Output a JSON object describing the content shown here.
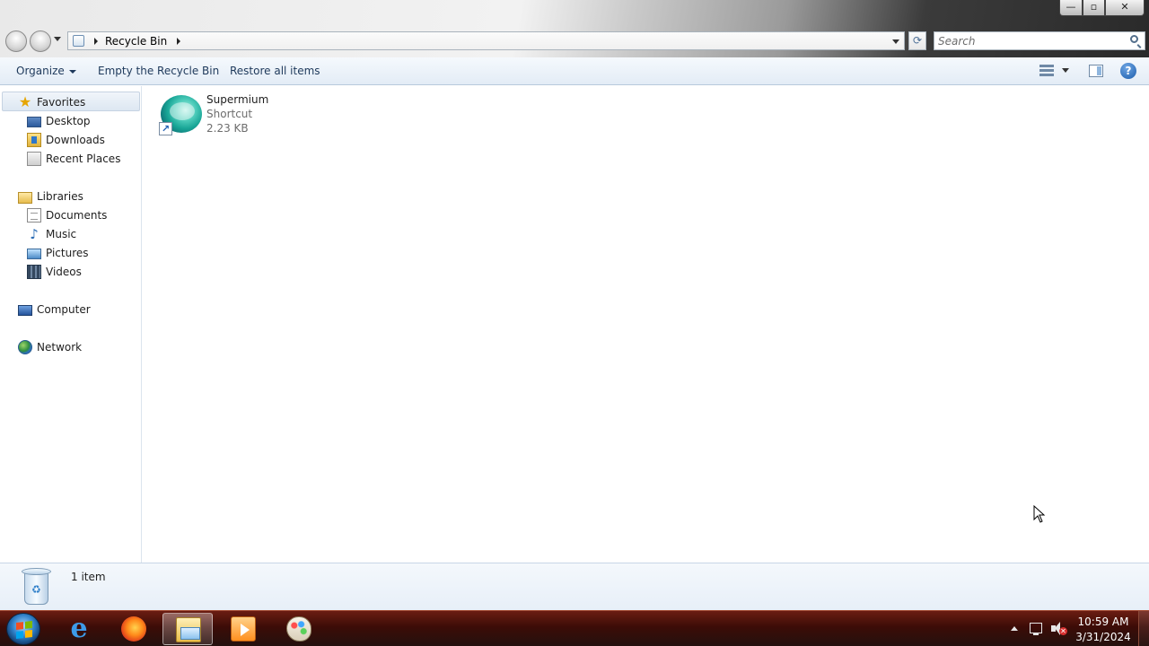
{
  "window": {
    "controls": {
      "minimize": "—",
      "maximize": "▫",
      "close": "✕"
    }
  },
  "address_bar": {
    "breadcrumb": "Recycle Bin",
    "refresh_glyph": "⟳"
  },
  "search": {
    "placeholder": "Search"
  },
  "command_bar": {
    "organize_label": "Organize",
    "empty_label": "Empty the Recycle Bin",
    "restore_label": "Restore all items",
    "help_glyph": "?"
  },
  "nav_pane": {
    "favorites": {
      "label": "Favorites",
      "items": [
        {
          "label": "Desktop",
          "icon": "desktop-icon"
        },
        {
          "label": "Downloads",
          "icon": "downloads-icon"
        },
        {
          "label": "Recent Places",
          "icon": "recent-places-icon"
        }
      ]
    },
    "libraries": {
      "label": "Libraries",
      "items": [
        {
          "label": "Documents",
          "icon": "documents-icon"
        },
        {
          "label": "Music",
          "icon": "music-icon"
        },
        {
          "label": "Pictures",
          "icon": "pictures-icon"
        },
        {
          "label": "Videos",
          "icon": "videos-icon"
        }
      ]
    },
    "computer": {
      "label": "Computer"
    },
    "network": {
      "label": "Network"
    }
  },
  "content": {
    "items": [
      {
        "name": "Supermium",
        "type": "Shortcut",
        "size": "2.23 KB"
      }
    ]
  },
  "details": {
    "count": "1 item"
  },
  "taskbar": {
    "apps": [
      "internet-explorer",
      "firefox",
      "windows-explorer",
      "media-player",
      "paint"
    ],
    "active_app": "windows-explorer"
  },
  "tray": {
    "time": "10:59 AM",
    "date": "3/31/2024",
    "volume_muted": true
  },
  "colors": {
    "accent": "#1e395b",
    "taskbar": "#3c0c07",
    "selection": "#dde7f2"
  }
}
